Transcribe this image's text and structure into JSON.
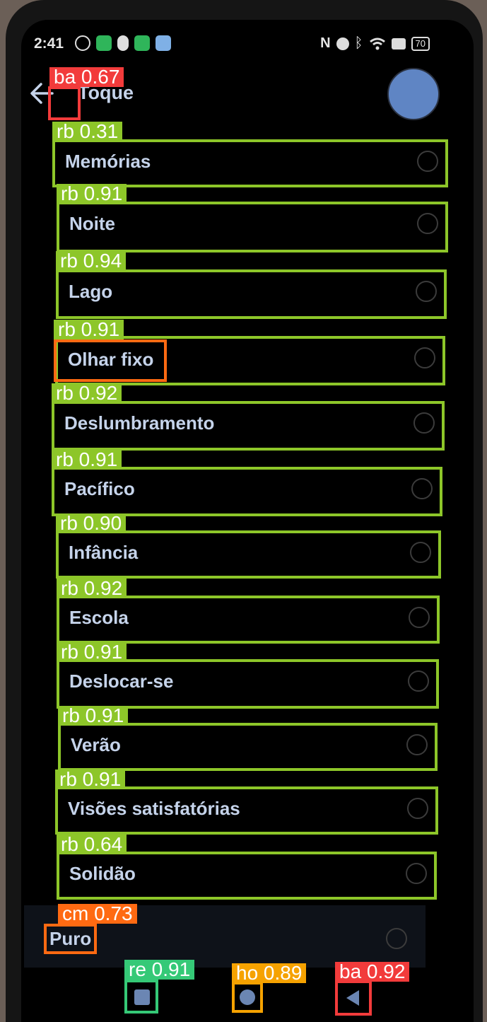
{
  "status_bar": {
    "time": "2:41",
    "battery": "70",
    "left_icons": [
      "settings-icon",
      "grid-app-icon",
      "bug-icon",
      "app-icon",
      "app-icon-2"
    ],
    "right_icons": [
      "nfc-icon",
      "alarm-icon",
      "bluetooth-icon",
      "wifi-icon",
      "sim-icon"
    ]
  },
  "header": {
    "title": "Toque",
    "back_icon": "arrow-left-icon"
  },
  "list": {
    "items": [
      {
        "label": "Memórias"
      },
      {
        "label": "Noite"
      },
      {
        "label": "Lago"
      },
      {
        "label": "Olhar fixo"
      },
      {
        "label": "Deslumbramento"
      },
      {
        "label": "Pacífico"
      },
      {
        "label": "Infância"
      },
      {
        "label": "Escola"
      },
      {
        "label": "Deslocar-se"
      },
      {
        "label": "Verão"
      },
      {
        "label": "Visões satisfatórias"
      },
      {
        "label": "Solidão"
      }
    ],
    "selected": {
      "label": "Puro"
    }
  },
  "detections": [
    {
      "text": "ba 0.67"
    },
    {
      "text": "rb 0.31"
    },
    {
      "text": "rb 0.91"
    },
    {
      "text": "rb 0.94"
    },
    {
      "text": "rb 0.91"
    },
    {
      "text": "rb 0.92"
    },
    {
      "text": "rb 0.91"
    },
    {
      "text": "rb 0.90"
    },
    {
      "text": "rb 0.92"
    },
    {
      "text": "rb 0.91"
    },
    {
      "text": "rb 0.91"
    },
    {
      "text": "rb 0.91"
    },
    {
      "text": "rb 0.64"
    },
    {
      "text": "cm 0.73"
    },
    {
      "text": "re 0.91"
    },
    {
      "text": "ho 0.89"
    },
    {
      "text": "ba 0.92"
    }
  ],
  "colors": {
    "rb": "#8dc629",
    "ba": "#f23b3b",
    "cm": "#ff6a12",
    "re": "#35c977",
    "ho": "#f6a200"
  },
  "nav": {
    "recents_icon": "square-icon",
    "home_icon": "circle-icon",
    "back_icon": "triangle-back-icon"
  }
}
